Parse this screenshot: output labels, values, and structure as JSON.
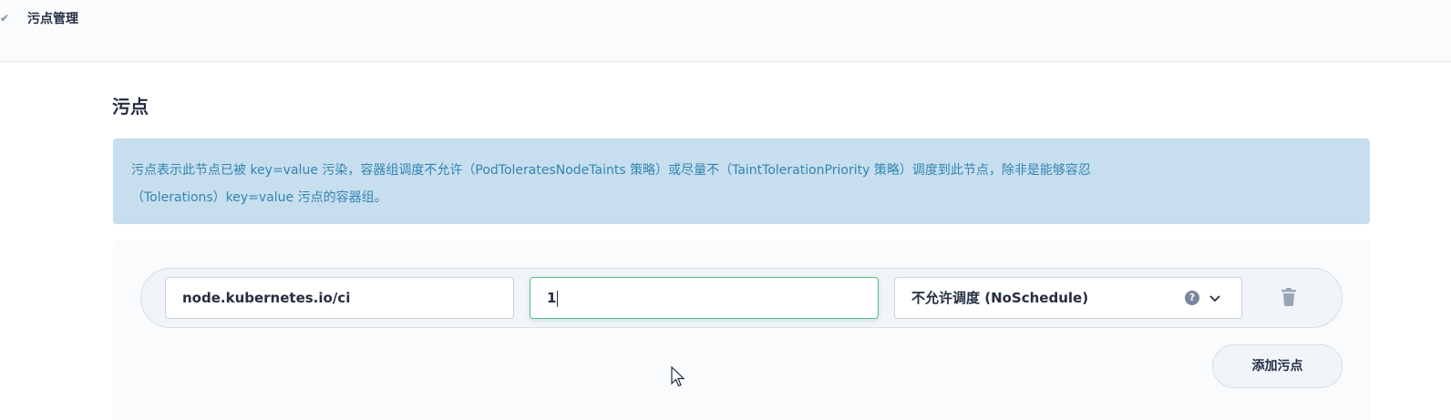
{
  "header": {
    "title": "污点管理",
    "icon": "pin-icon"
  },
  "section": {
    "title": "污点",
    "info_line1": "污点表示此节点已被 key=value 污染，容器组调度不允许（PodToleratesNodeTaints 策略）或尽量不（TaintTolerationPriority 策略）调度到此节点，除非是能够容忍",
    "info_line2": "（Tolerations）key=value 污点的容器组。"
  },
  "taints": [
    {
      "key": "node.kubernetes.io/ci",
      "value": "1",
      "effect": "不允许调度 (NoSchedule)"
    }
  ],
  "actions": {
    "add_label": "添加污点",
    "help_symbol": "?"
  },
  "colors": {
    "accent_green": "#55bc8a",
    "info_bg": "#c7deef",
    "info_text": "#3385b0"
  }
}
